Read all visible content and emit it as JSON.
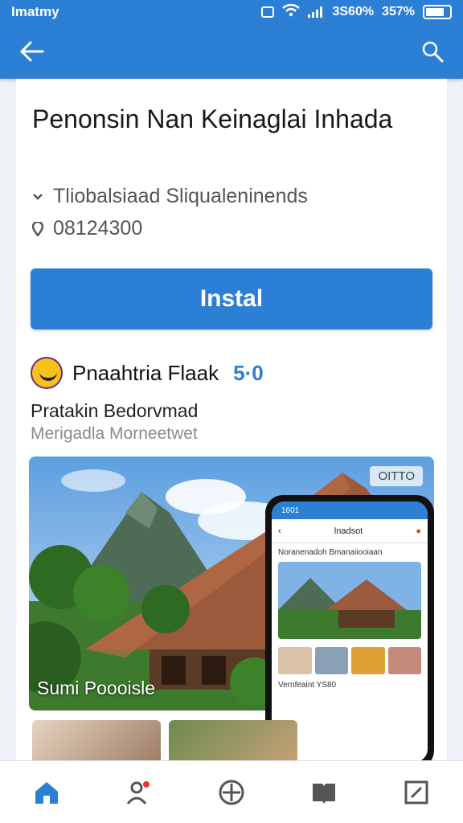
{
  "status_bar": {
    "app_name": "Imatmy",
    "signal_text": "3S60%",
    "battery_text": "357%"
  },
  "app_bar": {
    "back_icon": "arrow-left-icon",
    "search_icon": "search-icon"
  },
  "app": {
    "title": "Penonsin Nan Keinaglai Inhada",
    "meta_category": "Tliobalsiaad Sliqualeninends",
    "meta_number": "08124300",
    "install_label": "Instal",
    "developer_name": "Pnaahtria Flaak",
    "developer_rating": "5·0"
  },
  "section": {
    "title": "Pratakin Bedorvmad",
    "subtitle": "Merigadla Morneetwet"
  },
  "hero": {
    "caption": "Sumi Poooisle",
    "badge": "OITTO"
  },
  "phone_mockup": {
    "time": "1601",
    "header": "lnadsot",
    "line": "Noranenadoh Bmanaiiooiaan",
    "footer": "Vernfeaint",
    "footer_num": "YS80"
  },
  "colors": {
    "primary": "#2b7fd4",
    "rating": "#2b7fd4"
  },
  "bottom_nav": {
    "items": [
      "home-icon",
      "profile-icon",
      "add-circle-icon",
      "book-icon",
      "edit-icon"
    ]
  }
}
